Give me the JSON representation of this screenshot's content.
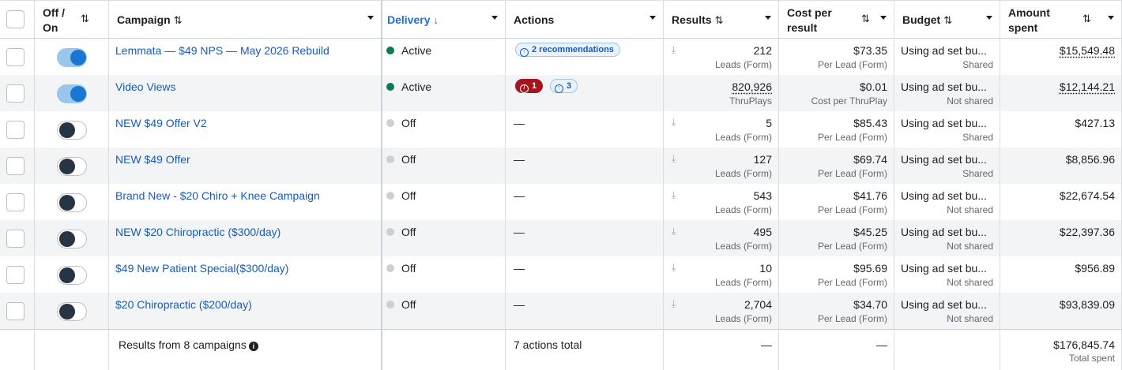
{
  "header": {
    "toggle_label_1": "Off /",
    "toggle_label_2": "On",
    "campaign": "Campaign",
    "delivery": "Delivery",
    "actions": "Actions",
    "results": "Results",
    "cost_1": "Cost per",
    "cost_2": "result",
    "budget": "Budget",
    "amount_1": "Amount",
    "amount_2": "spent",
    "sort_glyph": "⇅",
    "sort_down_glyph": "↓"
  },
  "rows": [
    {
      "on": true,
      "name": "Lemmata — $49 NPS — May 2026 Rebuild",
      "delivery": "Active",
      "delivery_status": "active",
      "actions": {
        "type": "rec",
        "rec_label": "2 recommendations"
      },
      "results": "212",
      "results_sub": "Leads (Form)",
      "results_dotted": false,
      "dl": true,
      "cost": "$73.35",
      "cost_sub": "Per Lead (Form)",
      "budget": "Using ad set bu...",
      "budget_sub": "Shared",
      "amount": "$15,549.48",
      "amount_dotted": true
    },
    {
      "on": true,
      "name": "Video Views",
      "delivery": "Active",
      "delivery_status": "active",
      "actions": {
        "type": "err_rec",
        "err_count": "1",
        "rec_count": "3"
      },
      "results": "820,926",
      "results_sub": "ThruPlays",
      "results_dotted": true,
      "dl": false,
      "cost": "$0.01",
      "cost_sub": "Cost per ThruPlay",
      "budget": "Using ad set bu...",
      "budget_sub": "Not shared",
      "amount": "$12,144.21",
      "amount_dotted": true
    },
    {
      "on": false,
      "name": "NEW $49 Offer V2",
      "delivery": "Off",
      "delivery_status": "off",
      "actions": {
        "type": "none",
        "text": "—"
      },
      "results": "5",
      "results_sub": "Leads (Form)",
      "results_dotted": false,
      "dl": true,
      "cost": "$85.43",
      "cost_sub": "Per Lead (Form)",
      "budget": "Using ad set bu...",
      "budget_sub": "Shared",
      "amount": "$427.13",
      "amount_dotted": false
    },
    {
      "on": false,
      "name": "NEW $49 Offer",
      "delivery": "Off",
      "delivery_status": "off",
      "actions": {
        "type": "none",
        "text": "—"
      },
      "results": "127",
      "results_sub": "Leads (Form)",
      "results_dotted": false,
      "dl": true,
      "cost": "$69.74",
      "cost_sub": "Per Lead (Form)",
      "budget": "Using ad set bu...",
      "budget_sub": "Shared",
      "amount": "$8,856.96",
      "amount_dotted": false
    },
    {
      "on": false,
      "name": "Brand New - $20 Chiro + Knee Campaign",
      "delivery": "Off",
      "delivery_status": "off",
      "actions": {
        "type": "none",
        "text": "—"
      },
      "results": "543",
      "results_sub": "Leads (Form)",
      "results_dotted": false,
      "dl": true,
      "cost": "$41.76",
      "cost_sub": "Per Lead (Form)",
      "budget": "Using ad set bu...",
      "budget_sub": "Not shared",
      "amount": "$22,674.54",
      "amount_dotted": false
    },
    {
      "on": false,
      "name": "NEW $20 Chiropractic ($300/day)",
      "delivery": "Off",
      "delivery_status": "off",
      "actions": {
        "type": "none",
        "text": "—"
      },
      "results": "495",
      "results_sub": "Leads (Form)",
      "results_dotted": false,
      "dl": true,
      "cost": "$45.25",
      "cost_sub": "Per Lead (Form)",
      "budget": "Using ad set bu...",
      "budget_sub": "Not shared",
      "amount": "$22,397.36",
      "amount_dotted": false
    },
    {
      "on": false,
      "name": "$49 New Patient Special($300/day)",
      "delivery": "Off",
      "delivery_status": "off",
      "actions": {
        "type": "none",
        "text": "—"
      },
      "results": "10",
      "results_sub": "Leads (Form)",
      "results_dotted": false,
      "dl": true,
      "cost": "$95.69",
      "cost_sub": "Per Lead (Form)",
      "budget": "Using ad set bu...",
      "budget_sub": "Not shared",
      "amount": "$956.89",
      "amount_dotted": false
    },
    {
      "on": false,
      "name": "$20 Chiropractic ($200/day)",
      "delivery": "Off",
      "delivery_status": "off",
      "actions": {
        "type": "none",
        "text": "—"
      },
      "results": "2,704",
      "results_sub": "Leads (Form)",
      "results_dotted": false,
      "dl": true,
      "cost": "$34.70",
      "cost_sub": "Per Lead (Form)",
      "budget": "Using ad set bu...",
      "budget_sub": "Not shared",
      "amount": "$93,839.09",
      "amount_dotted": false
    }
  ],
  "footer": {
    "results_from": "Results from 8 campaigns",
    "actions_total": "7 actions total",
    "results_dash": "—",
    "cost_dash": "—",
    "amount_total": "$176,845.74",
    "amount_sub": "Total spent"
  },
  "colors": {
    "link": "#1a5bb5",
    "active_dot": "#0b7a52",
    "off_dot": "#ccd0d5",
    "toggle_on": "#1877d2",
    "error_badge": "#a8141d"
  },
  "icons": {
    "sort": "sort-arrows-icon",
    "download": "download-icon",
    "info": "info-icon",
    "caret": "chevron-down-icon"
  }
}
